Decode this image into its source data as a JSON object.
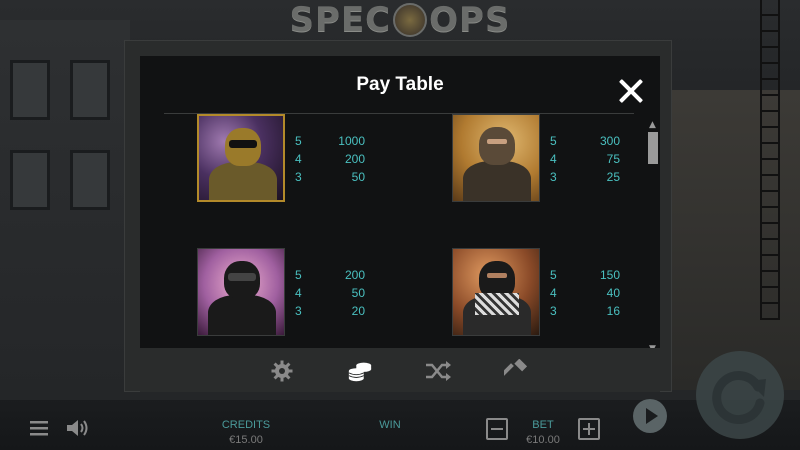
{
  "game": {
    "logo_left": "SPEC",
    "logo_right": "OPS"
  },
  "paytable": {
    "title": "Pay Table",
    "symbols": [
      {
        "name": "gold-soldier",
        "pays": [
          {
            "count": "5",
            "value": "1000"
          },
          {
            "count": "4",
            "value": "200"
          },
          {
            "count": "3",
            "value": "50"
          }
        ]
      },
      {
        "name": "desert-soldier",
        "pays": [
          {
            "count": "5",
            "value": "300"
          },
          {
            "count": "4",
            "value": "75"
          },
          {
            "count": "3",
            "value": "25"
          }
        ]
      },
      {
        "name": "swat-soldier",
        "pays": [
          {
            "count": "5",
            "value": "200"
          },
          {
            "count": "4",
            "value": "50"
          },
          {
            "count": "3",
            "value": "20"
          }
        ]
      },
      {
        "name": "masked-terrorist",
        "pays": [
          {
            "count": "5",
            "value": "150"
          },
          {
            "count": "4",
            "value": "40"
          },
          {
            "count": "3",
            "value": "16"
          }
        ]
      }
    ]
  },
  "nav": {
    "icons": [
      "gear-icon",
      "coins-icon",
      "shuffle-icon",
      "hammer-icon"
    ],
    "active": "coins-icon"
  },
  "hud": {
    "credits_label": "CREDITS",
    "credits_value": "€15.00",
    "win_label": "WIN",
    "bet_label": "BET",
    "bet_value": "€10.00"
  },
  "colors": {
    "accent_teal": "#4ac0c0",
    "gold_border": "#b38a2a",
    "modal_bg": "#111213"
  }
}
